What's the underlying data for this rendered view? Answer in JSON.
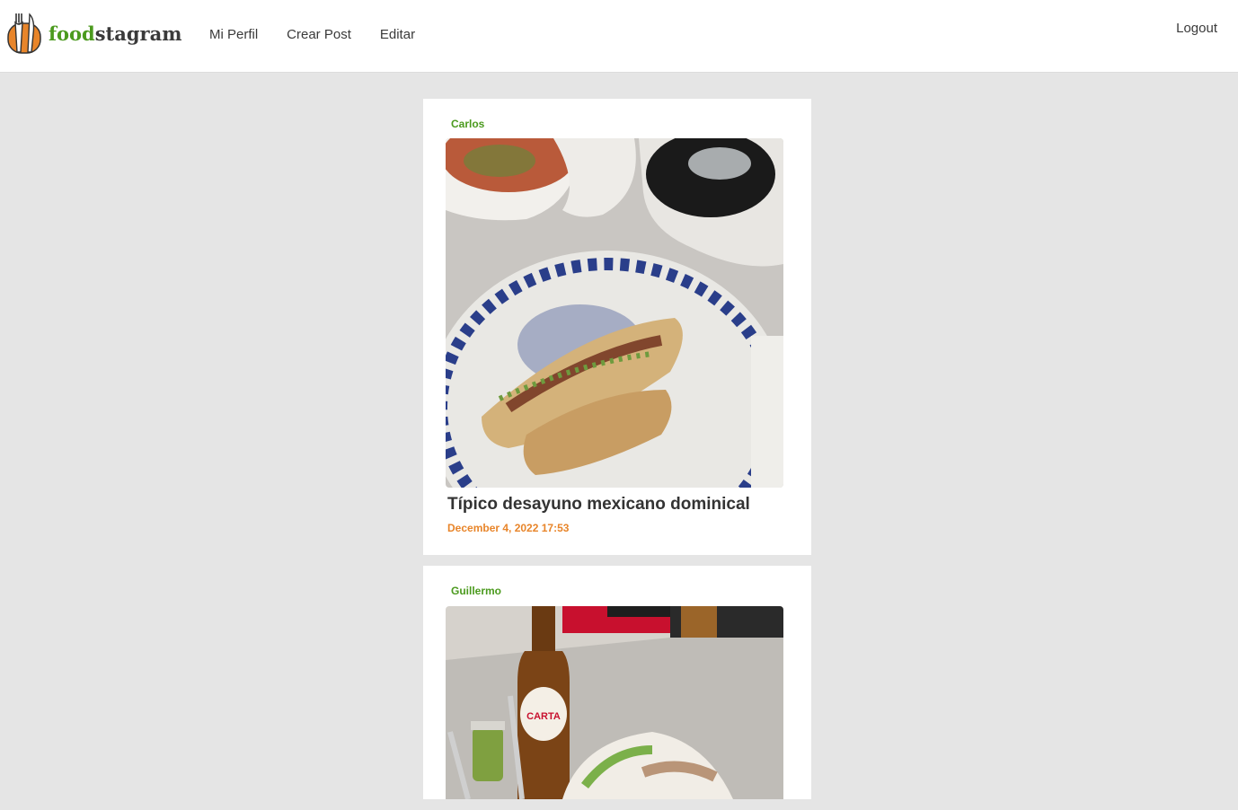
{
  "brand": {
    "name_part1": "food",
    "name_part2": "stagram",
    "logo_icon": "fork-knife-bottle-icon",
    "colors": {
      "food": "#4b9a1e",
      "stagram": "#3a3a3a",
      "accent": "#e8852a"
    }
  },
  "nav": {
    "links": [
      {
        "label": "Mi Perfil"
      },
      {
        "label": "Crear Post"
      },
      {
        "label": "Editar"
      }
    ],
    "logout_label": "Logout"
  },
  "posts": [
    {
      "author": "Carlos",
      "image_alt": "food-photo",
      "caption": "Típico desayuno mexicano dominical",
      "timestamp": "December 4, 2022 17:53"
    },
    {
      "author": "Guillermo",
      "image_alt": "food-photo"
    }
  ]
}
